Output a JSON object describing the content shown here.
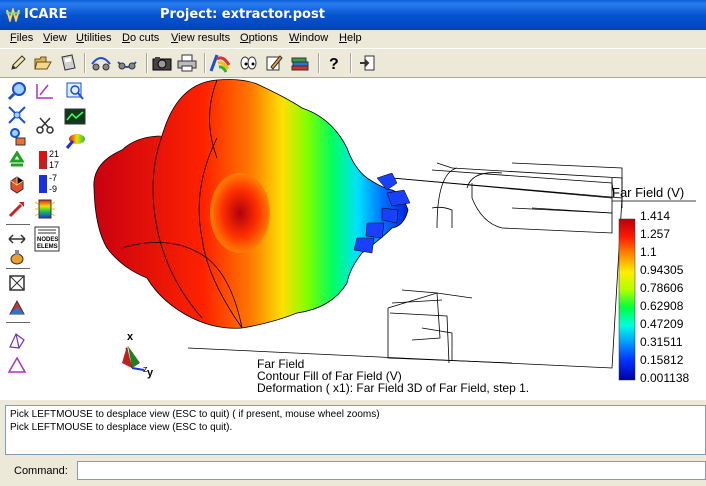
{
  "window": {
    "app_name": "ICARE",
    "title": "Project: extractor.post"
  },
  "menu": [
    "Files",
    "View",
    "Utilities",
    "Do cuts",
    "View results",
    "Options",
    "Window",
    "Help"
  ],
  "toolbar_icons": [
    "pencil-icon",
    "open-folder-icon",
    "save-disk-icon",
    "rotate-view-icon",
    "rotate-view-alt-icon",
    "camera-icon",
    "printer-icon",
    "color-brush-icon",
    "eyes-icon",
    "edit-pen-icon",
    "books-icon",
    "help-icon",
    "exit-icon"
  ],
  "palette_icons": [
    "zoom-in-icon",
    "measure-icon",
    "zoom-out-icon",
    "fit-icon",
    "graph-icon",
    "cut-icon",
    "pick-icon",
    "color-drop-icon",
    "recycle-icon",
    "scale-icon",
    "explode-icon",
    "scale-small-icon",
    "pointer-icon",
    "spectrum-icon",
    "arrows-icon",
    "nodes-elems-icon",
    "lamp-icon",
    "box-icon",
    "mesh-icon",
    "wire-icon",
    "triangle-icon"
  ],
  "palette_labels": {
    "scale_values": [
      "21",
      "17",
      "-7",
      "-9"
    ],
    "nodes": "NODES",
    "elems": "ELEMS"
  },
  "axes": {
    "x": "x",
    "y": "y",
    "z": "z"
  },
  "legend": {
    "title": "Far Field (V)",
    "values": [
      "1.414",
      "1.257",
      "1.1",
      "0.94305",
      "0.78606",
      "0.62908",
      "0.47209",
      "0.31511",
      "0.15812",
      "0.001138"
    ],
    "colors": {
      "max": "#b8000e",
      "high": "#ff1a00",
      "upper": "#ff8a00",
      "mid_high": "#ffee00",
      "mid": "#b0ff00",
      "mid_low": "#00ff40",
      "low_mid": "#00ffe0",
      "low": "#0098ff",
      "lower": "#0030ff",
      "min": "#0000a0"
    }
  },
  "caption": {
    "line1": "Far Field",
    "line2": "Contour Fill of Far Field (V)",
    "line3": "Deformation ( x1): Far Field 3D of Far Field, step 1."
  },
  "messages": [
    "Pick LEFTMOUSE to desplace view (ESC to quit) ( if present, mouse wheel zooms)",
    "Pick LEFTMOUSE to desplace view (ESC to quit)."
  ],
  "command": {
    "label": "Command:",
    "value": ""
  }
}
